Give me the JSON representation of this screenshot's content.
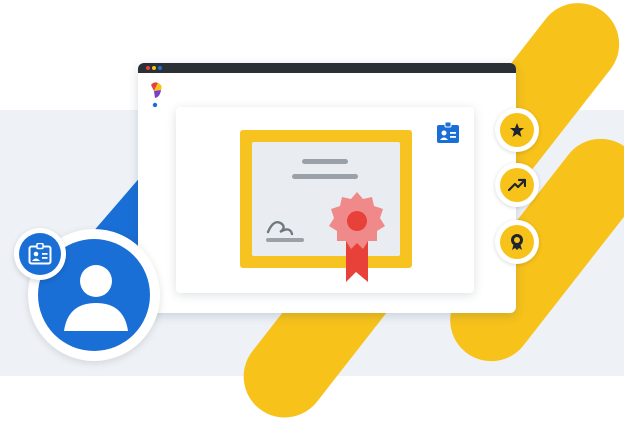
{
  "colors": {
    "yellow": "#f7c21a",
    "blue": "#1a6fd6",
    "red": "#e8413a",
    "pink": "#f08a8a",
    "dark": "#2b2f36"
  },
  "icons": {
    "window_logo": "colorful-logo-icon",
    "id_card": "id-card-icon",
    "star": "star-icon",
    "trend": "trending-up-icon",
    "award": "award-ribbon-icon",
    "user": "user-avatar-icon",
    "seal": "certificate-seal-icon"
  }
}
